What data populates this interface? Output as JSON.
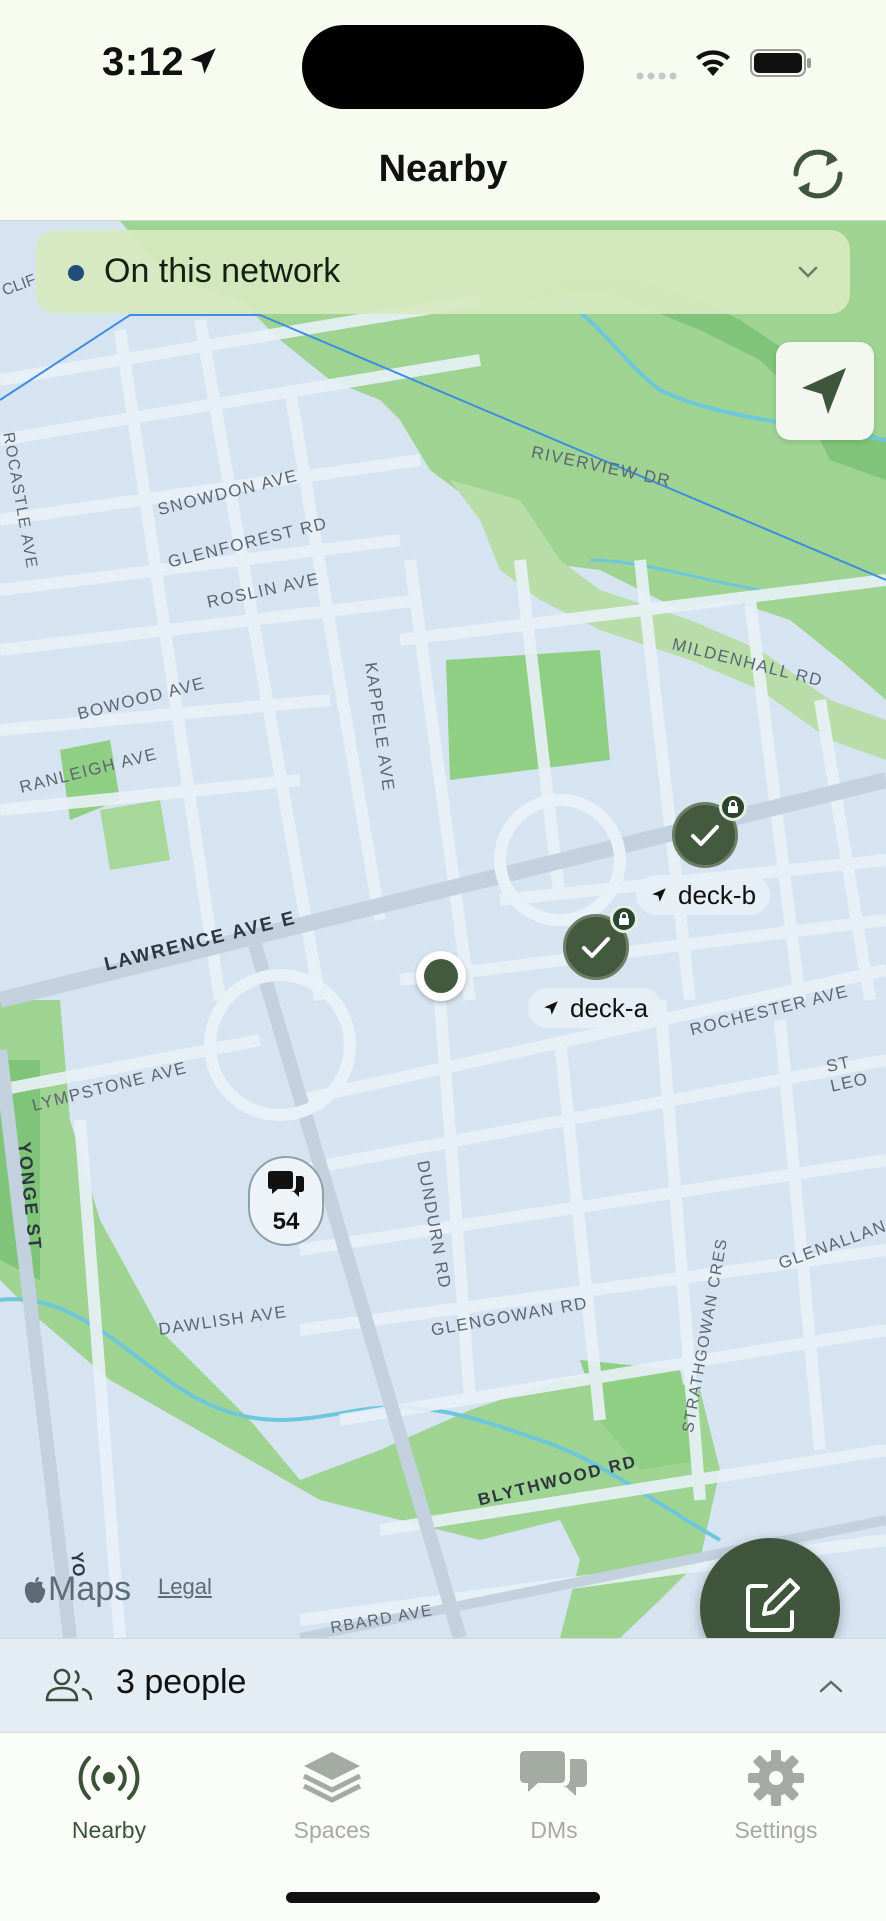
{
  "status_bar": {
    "time": "3:12"
  },
  "header": {
    "title": "Nearby"
  },
  "network_filter": {
    "label": "On this network"
  },
  "map": {
    "street_labels": [
      "RIVERVIEW DR",
      "SNOWDON AVE",
      "GLENFOREST RD",
      "ROSLIN AVE",
      "KAPPELE AVE",
      "MILDENHALL RD",
      "BOWOOD AVE",
      "RANLEIGH AVE",
      "LAWRENCE AVE E",
      "ROCHESTER AVE",
      "LYMPSTONE AVE",
      "YONGE ST",
      "DUNDURN RD",
      "DAWLISH AVE",
      "GLENGOWAN RD",
      "STRATHGOWAN CRES",
      "GLENALLAN",
      "BLYTHWOOD RD",
      "ST LEO",
      "ROCASTLE AVE",
      "CLIF",
      "YO",
      "RBARD AVE"
    ],
    "peers": [
      {
        "name": "deck-b",
        "verified": true,
        "locked": true
      },
      {
        "name": "deck-a",
        "verified": true,
        "locked": true
      }
    ],
    "message_cluster_count": "54",
    "attribution": "Maps",
    "legal_label": "Legal"
  },
  "people_summary": {
    "label": "3 people"
  },
  "tabs": [
    {
      "label": "Nearby",
      "icon": "broadcast-icon",
      "active": true
    },
    {
      "label": "Spaces",
      "icon": "layers-icon",
      "active": false
    },
    {
      "label": "DMs",
      "icon": "chat-bubbles-icon",
      "active": false
    },
    {
      "label": "Settings",
      "icon": "gear-icon",
      "active": false
    }
  ],
  "colors": {
    "accent": "#3f553c",
    "map_water_blue": "#d6e4f1",
    "park_green": "#8fcf83"
  }
}
